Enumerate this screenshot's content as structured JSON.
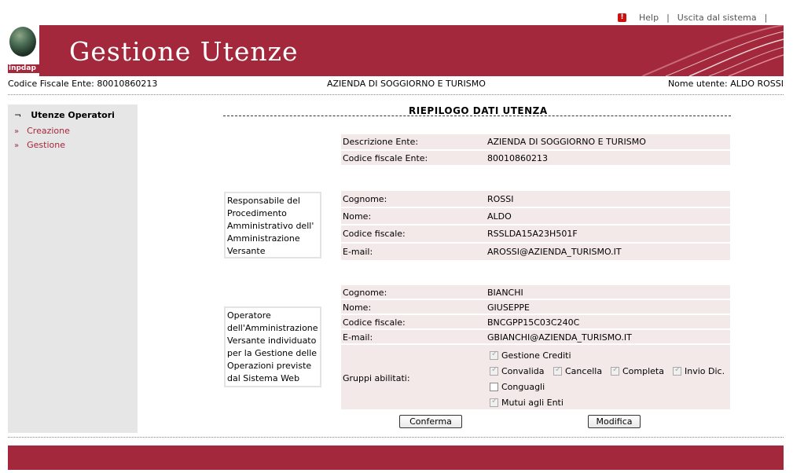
{
  "top_links": {
    "help": "Help",
    "sep1": "|",
    "logout": "Uscita dal sistema",
    "sep2": "|"
  },
  "header": {
    "title": "Gestione Utenze",
    "logo_text": "inpdap"
  },
  "info_bar": {
    "codice_fiscale_ente_label": "Codice Fiscale Ente:",
    "codice_fiscale_ente_value": "80010860213",
    "azienda": "AZIENDA DI SOGGIORNO E TURISMO",
    "nome_utente_label": "Nome utente:",
    "nome_utente_value": "ALDO ROSSI"
  },
  "sidebar": {
    "section_marker": "¬",
    "section_title": "Utenze Operatori",
    "item_marker": "»",
    "items": [
      {
        "label": "Creazione"
      },
      {
        "label": "Gestione"
      }
    ]
  },
  "main": {
    "title": "RIEPILOGO DATI UTENZA",
    "ente": [
      {
        "label": "Descrizione Ente:",
        "value": "AZIENDA DI SOGGIORNO E TURISMO"
      },
      {
        "label": "Codice fiscale Ente:",
        "value": "80010860213"
      }
    ],
    "responsabile": {
      "description": "Responsabile del Procedimento Amministrativo dell' Amministrazione Versante",
      "fields": [
        {
          "label": "Cognome:",
          "value": "ROSSI"
        },
        {
          "label": "Nome:",
          "value": "ALDO"
        },
        {
          "label": "Codice fiscale:",
          "value": "RSSLDA15A23H501F"
        },
        {
          "label": "E-mail:",
          "value": "AROSSI@AZIENDA_TURISMO.IT"
        }
      ]
    },
    "operatore": {
      "description": "Operatore dell'Amministrazione Versante individuato per la Gestione delle Operazioni previste dal Sistema Web",
      "fields": [
        {
          "label": "Cognome:",
          "value": "BIANCHI"
        },
        {
          "label": "Nome:",
          "value": "GIUSEPPE"
        },
        {
          "label": "Codice fiscale:",
          "value": "BNCGPP15C03C240C"
        },
        {
          "label": "E-mail:",
          "value": "GBIANCHI@AZIENDA_TURISMO.IT"
        }
      ],
      "gruppi_label": "Gruppi abilitati:",
      "gruppi": [
        {
          "label": "Gestione Crediti",
          "checked": true
        },
        {
          "label": "Convalida",
          "checked": true
        },
        {
          "label": "Cancella",
          "checked": true
        },
        {
          "label": "Completa",
          "checked": true
        },
        {
          "label": "Invio Dic.",
          "checked": true
        },
        {
          "label": "Conguagli",
          "checked": false
        },
        {
          "label": "Mutui agli Enti",
          "checked": true
        }
      ]
    },
    "buttons": {
      "confirm": "Conferma",
      "modify": "Modifica"
    }
  },
  "colors": {
    "brand": "#a3283c",
    "row_bg": "#f4e9e9",
    "sidebar_bg": "#e6e6e6"
  }
}
